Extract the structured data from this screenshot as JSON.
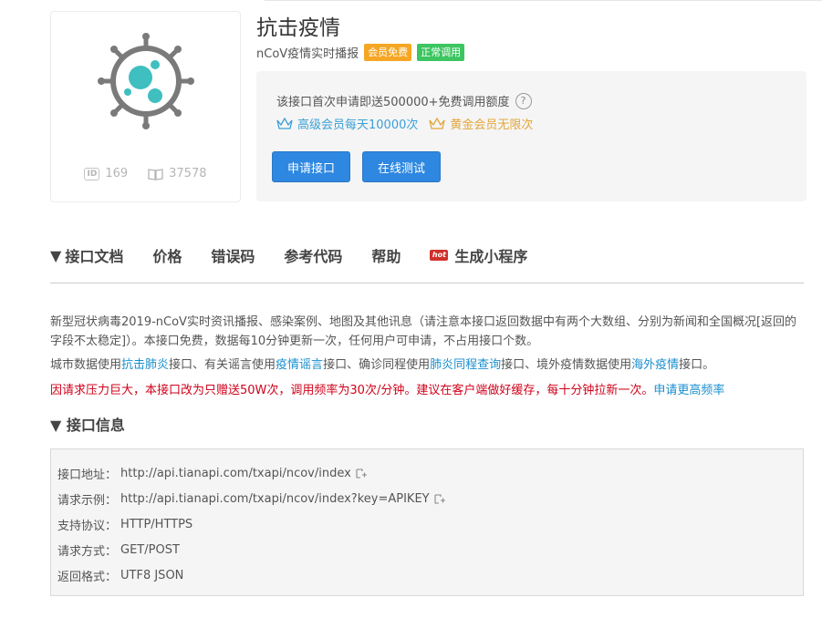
{
  "api": {
    "title": "抗击疫情",
    "subtitle": "nCoV疫情实时播报",
    "badge_member_free": "会员免费",
    "badge_normal": "正常调用",
    "id_label": "ID",
    "id_value": "169",
    "views_value": "37578"
  },
  "info_panel": {
    "free_text": "该接口首次申请即送500000+免费调用额度",
    "help_icon": "question-icon",
    "vip_senior": "高级会员每天10000次",
    "vip_gold": "黄金会员无限次",
    "apply_button": "申请接口",
    "test_button": "在线测试"
  },
  "tabs": [
    {
      "label": "接口文档",
      "arrow": "▼",
      "icon": "triangle-down-icon"
    },
    {
      "label": "价格"
    },
    {
      "label": "错误码"
    },
    {
      "label": "参考代码"
    },
    {
      "label": "帮助"
    },
    {
      "label": "生成小程序",
      "icon": "hot-icon",
      "icon_text": "hot"
    }
  ],
  "description": {
    "p1": "新型冠状病毒2019-nCoV实时资讯播报、感染案例、地图及其他讯息（请注意本接口返回数据中有两个大数组、分别为新闻和全国概况[返回的字段不太稳定]）。本接口免费，数据每10分钟更新一次，任何用户可申请，不占用接口个数。",
    "p2_a": "城市数据使用",
    "p2_link1": "抗击肺炎",
    "p2_b": "接口、有关谣言使用",
    "p2_link2": "疫情谣言",
    "p2_c": "接口、确诊同程使用",
    "p2_link3": "肺炎同程查询",
    "p2_d": "接口、境外疫情数据使用",
    "p2_link4": "海外疫情",
    "p2_e": "接口。",
    "p3": "因请求压力巨大，本接口改为只赠送50W次，调用频率为30次/分钟。建议在客户端做好缓存，每十分钟拉新一次。",
    "p3_link": "申请更高频率"
  },
  "section": {
    "title": "接口信息",
    "arrow": "▼"
  },
  "api_info": {
    "address_label": "接口地址：",
    "address_value": "http://api.tianapi.com/txapi/ncov/index",
    "example_label": "请求示例：",
    "example_value": "http://api.tianapi.com/txapi/ncov/index?key=APIKEY",
    "protocol_label": "支持协议：",
    "protocol_value": "HTTP/HTTPS",
    "method_label": "请求方式：",
    "method_value": "GET/POST",
    "format_label": "返回格式：",
    "format_value": "UTF8 JSON"
  },
  "colors": {
    "accent_blue": "#2e87e0",
    "link_blue": "#1a8fcf",
    "warning_red": "#d0021b",
    "badge_orange": "#f5a623",
    "badge_green": "#3cc560",
    "virus_gray": "#7a7a7a",
    "virus_teal": "#3fbfbf"
  }
}
